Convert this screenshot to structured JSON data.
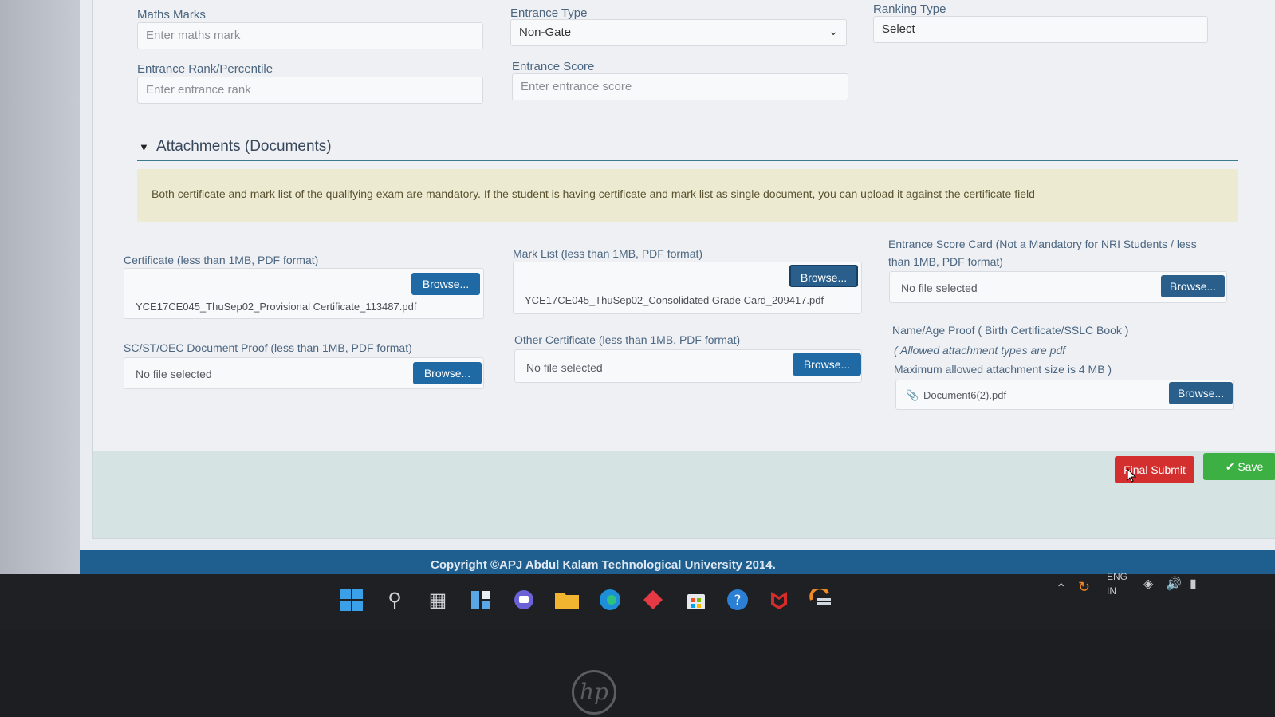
{
  "form": {
    "maths_marks": {
      "label": "Maths Marks",
      "placeholder": "Enter maths mark"
    },
    "entrance_type": {
      "label": "Entrance Type",
      "value": "Non-Gate"
    },
    "ranking_type": {
      "label": "Ranking Type",
      "value": "Select"
    },
    "entrance_rank": {
      "label": "Entrance Rank/Percentile",
      "placeholder": "Enter entrance rank"
    },
    "entrance_score": {
      "label": "Entrance Score",
      "placeholder": "Enter entrance score"
    }
  },
  "attachments": {
    "title": "Attachments (Documents)",
    "notice": "Both certificate and mark list of the qualifying exam are mandatory. If the student is having certificate and mark list as single document, you can upload it against the certificate field",
    "browse_label": "Browse...",
    "certificate": {
      "label": "Certificate (less than 1MB, PDF format)",
      "file": "YCE17CE045_ThuSep02_Provisional Certificate_113487.pdf"
    },
    "mark_list": {
      "label": "Mark List (less than 1MB, PDF format)",
      "file": "YCE17CE045_ThuSep02_Consolidated Grade Card_209417.pdf"
    },
    "entrance_card": {
      "label_line1": "Entrance Score Card (Not a Mandatory for NRI Students / less",
      "label_line2": "than 1MB, PDF format)",
      "file": "No file selected"
    },
    "sc_st": {
      "label": "SC/ST/OEC Document Proof (less than 1MB, PDF format)",
      "file": "No file selected"
    },
    "other_cert": {
      "label": "Other Certificate (less than 1MB, PDF format)",
      "file": "No file selected"
    },
    "name_age": {
      "label": "Name/Age Proof ( Birth Certificate/SSLC Book )",
      "note1": "( Allowed attachment types are pdf",
      "note2": "Maximum allowed attachment size is 4 MB )",
      "file": "Document6(2).pdf"
    }
  },
  "actions": {
    "final_submit": "Final Submit",
    "save": "Save"
  },
  "footer": {
    "copyright": "Copyright ©APJ Abdul Kalam Technological University 2014."
  },
  "taskbar": {
    "icons": [
      "windows-start-icon",
      "search-icon",
      "task-view-icon",
      "widgets-icon",
      "chat-icon",
      "file-explorer-icon",
      "edge-browser-icon",
      "app-red-diamond-icon",
      "store-icon",
      "help-icon",
      "mcafee-icon",
      "app-orange-icon"
    ],
    "lang_line1": "ENG",
    "lang_line2": "IN"
  },
  "colors": {
    "primary": "#1f6aa5",
    "danger": "#d32f2f",
    "success": "#3cb043",
    "footer": "#1e5f8f"
  }
}
